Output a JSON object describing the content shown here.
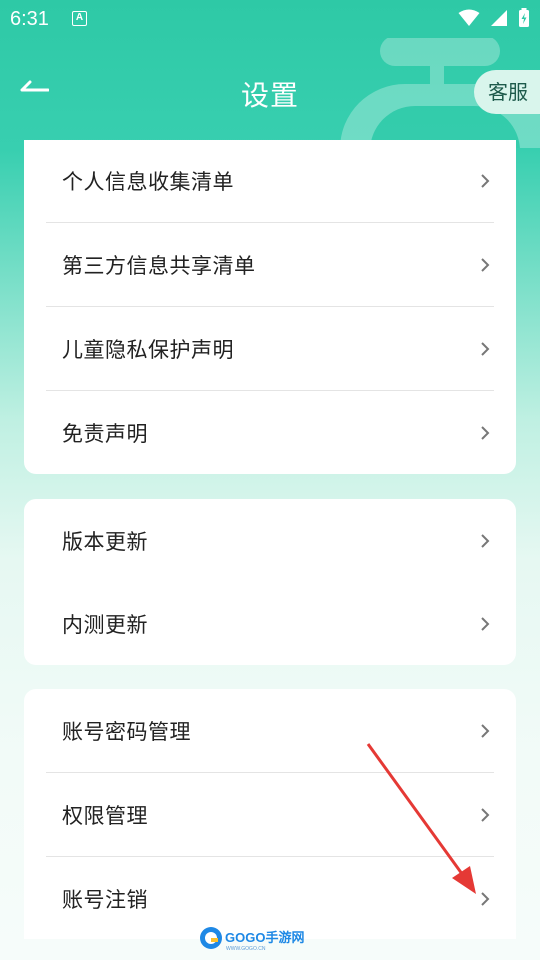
{
  "status_bar": {
    "time": "6:31",
    "notification_icon": "a-box-icon"
  },
  "header": {
    "title": "设置",
    "back_icon": "back-arrow-icon",
    "service_label": "客服"
  },
  "groups": [
    {
      "items": [
        {
          "label": "个人信息收集清单"
        },
        {
          "label": "第三方信息共享清单"
        },
        {
          "label": "儿童隐私保护声明"
        },
        {
          "label": "免责声明"
        }
      ]
    },
    {
      "items": [
        {
          "label": "版本更新"
        },
        {
          "label": "内测更新"
        }
      ]
    },
    {
      "items": [
        {
          "label": "账号密码管理"
        },
        {
          "label": "权限管理"
        },
        {
          "label": "账号注销"
        }
      ]
    }
  ],
  "watermark": {
    "brand": "GOGO手游网",
    "site": "www.gogo.cn"
  },
  "colors": {
    "accent": "#2ec9a6",
    "annotation": "#e53935"
  }
}
